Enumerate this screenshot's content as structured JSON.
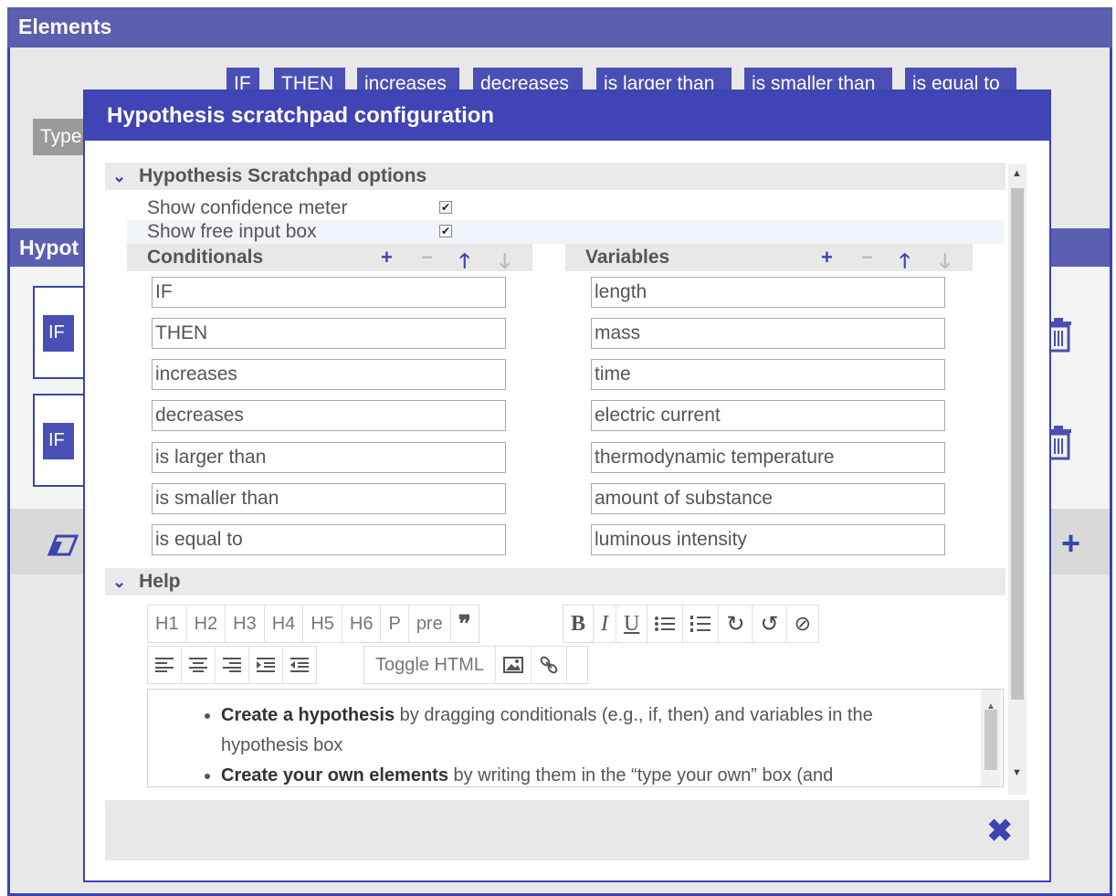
{
  "background": {
    "elements_title": "Elements",
    "chips": [
      "IF",
      "THEN",
      "increases",
      "decreases",
      "is larger than",
      "is smaller than",
      "is equal to"
    ],
    "type_own_label": "Type",
    "hypotheses_title": "Hypot",
    "row_if": "IF"
  },
  "modal": {
    "title": "Hypothesis scratchpad configuration",
    "options_section": "Hypothesis Scratchpad options",
    "options": [
      {
        "label": "Show confidence meter",
        "checked": true
      },
      {
        "label": "Show free input box",
        "checked": true
      }
    ],
    "conditionals_title": "Conditionals",
    "variables_title": "Variables",
    "conditionals": [
      "IF",
      "THEN",
      "increases",
      "decreases",
      "is larger than",
      "is smaller than",
      "is equal to"
    ],
    "variables": [
      "length",
      "mass",
      "time",
      "electric current",
      "thermodynamic temperature",
      "amount of substance",
      "luminous intensity"
    ],
    "help_section": "Help",
    "toolbar_row1_group1": [
      "H1",
      "H2",
      "H3",
      "H4",
      "H5",
      "H6",
      "P",
      "pre"
    ],
    "toolbar_row2_toggle": "Toggle HTML",
    "help_items": [
      {
        "bold": "Create a hypothesis",
        "text": " by dragging conditionals (e.g., if, then) and variables in the hypothesis box"
      },
      {
        "bold": "Create your own elements",
        "text": " by writing them in the “type your own” box (and"
      }
    ]
  },
  "colors": {
    "accent": "#4044b4",
    "header_bg": "#5a5fb0"
  }
}
